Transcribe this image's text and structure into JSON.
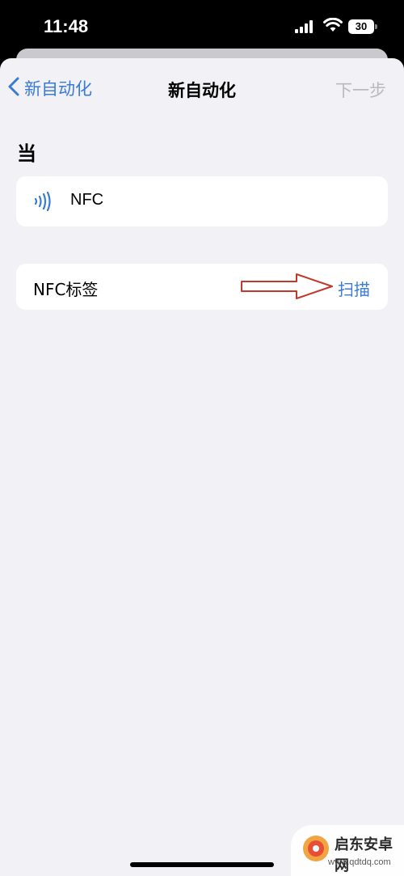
{
  "status_bar": {
    "time": "11:48",
    "battery": "30",
    "icons": [
      "signal-icon",
      "wifi-icon",
      "battery-icon"
    ]
  },
  "nav": {
    "back_label": "新自动化",
    "title": "新自动化",
    "next_label": "下一步",
    "back_icon": "chevron-left-icon",
    "colors": {
      "accent": "#3a7bd5",
      "disabled": "#b9b9be"
    }
  },
  "section": {
    "header": "当"
  },
  "trigger": {
    "label": "NFC",
    "icon": "nfc-icon"
  },
  "nfc_tag": {
    "label": "NFC标签",
    "scan_label": "扫描"
  },
  "annotation": {
    "icon": "red-arrow-icon",
    "color": "#c0392b"
  },
  "watermark": {
    "name": "启东安卓网",
    "url": "www.qdtdq.com"
  }
}
